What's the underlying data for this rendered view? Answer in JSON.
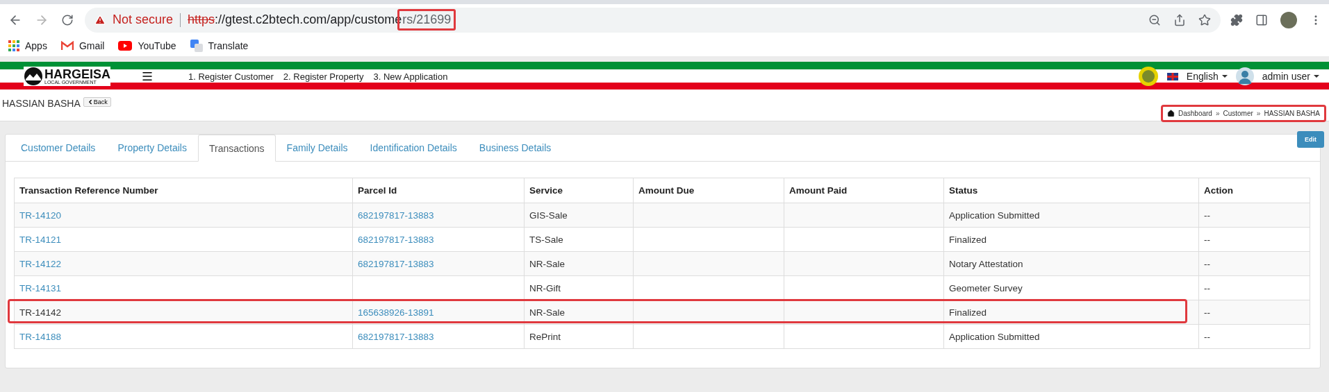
{
  "browser": {
    "security_label": "Not secure",
    "url_parts": [
      {
        "kind": "scheme",
        "text": "https"
      },
      {
        "kind": "plain",
        "text": "://gtest.c2btech.com/app/custome"
      },
      {
        "kind": "highlighted",
        "text": "rs/21699"
      }
    ],
    "bookmarks": [
      {
        "kind": "apps",
        "label": "Apps"
      },
      {
        "kind": "gmail",
        "label": "Gmail"
      },
      {
        "kind": "youtube",
        "label": "YouTube"
      },
      {
        "kind": "translate",
        "label": "Translate"
      }
    ]
  },
  "header": {
    "logo_title": "HARGEISA",
    "logo_subtitle": "LOCAL GOVERNMENT",
    "nav_links": [
      "1. Register Customer",
      "2. Register Property",
      "3. New Application"
    ],
    "language": "English",
    "user": "admin user"
  },
  "page": {
    "title": "HASSIAN BASHA",
    "back_button": "Back",
    "breadcrumb": {
      "highlighted": true,
      "separator": "»",
      "items": [
        "Dashboard",
        "Customer",
        "HASSIAN BASHA"
      ]
    }
  },
  "tabs": [
    {
      "label": "Customer Details",
      "selected": false
    },
    {
      "label": "Property Details",
      "selected": false
    },
    {
      "label": "Transactions",
      "selected": true
    },
    {
      "label": "Family Details",
      "selected": false
    },
    {
      "label": "Identification Details",
      "selected": false
    },
    {
      "label": "Business Details",
      "selected": false
    }
  ],
  "edit_button": "Edit",
  "table": {
    "columns": [
      "Transaction Reference Number",
      "Parcel Id",
      "Service",
      "Amount Due",
      "Amount Paid",
      "Status",
      "Action"
    ],
    "rows": [
      {
        "ref": "TR-14120",
        "ref_link": true,
        "parcel": "682197817-13883",
        "service": "GIS-Sale",
        "status": "Application Submitted",
        "action": "--",
        "highlighted": false
      },
      {
        "ref": "TR-14121",
        "ref_link": true,
        "parcel": "682197817-13883",
        "service": "TS-Sale",
        "status": "Finalized",
        "action": "--",
        "highlighted": false
      },
      {
        "ref": "TR-14122",
        "ref_link": true,
        "parcel": "682197817-13883",
        "service": "NR-Sale",
        "status": "Notary Attestation",
        "action": "--",
        "highlighted": false
      },
      {
        "ref": "TR-14131",
        "ref_link": true,
        "service": "NR-Gift",
        "status": "Geometer Survey",
        "action": "--",
        "highlighted": false
      },
      {
        "ref": "TR-14142",
        "ref_link": false,
        "parcel": "165638926-13891",
        "service": "NR-Sale",
        "status": "Finalized",
        "action": "--",
        "highlighted": true
      },
      {
        "ref": "TR-14188",
        "ref_link": true,
        "parcel": "682197817-13883",
        "service": "RePrint",
        "status": "Application Submitted",
        "action": "--",
        "highlighted": false
      }
    ]
  }
}
